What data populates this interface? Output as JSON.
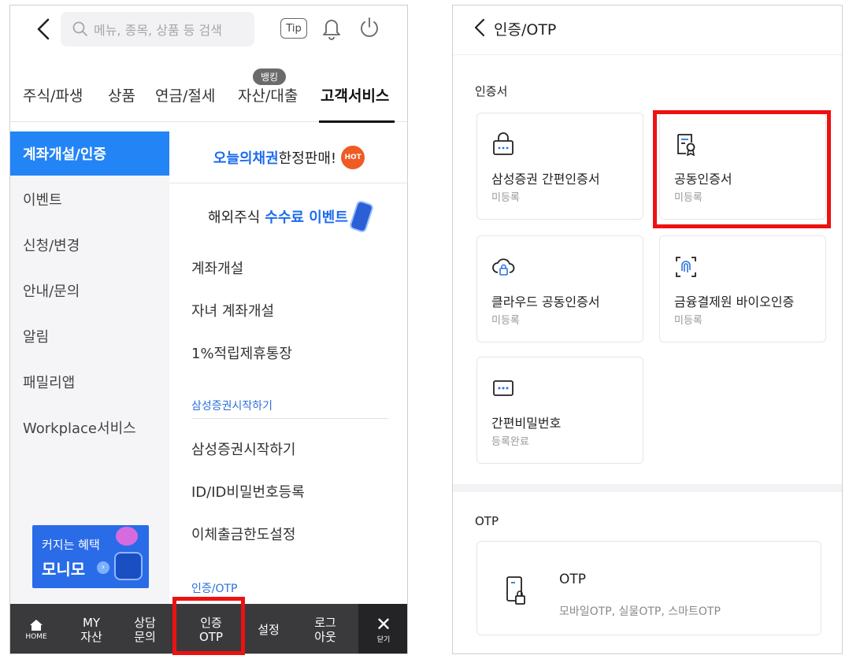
{
  "left": {
    "search": {
      "placeholder": "메뉴, 종목, 상품 등 검색"
    },
    "header": {
      "tip_label": "Tip"
    },
    "tabs": [
      {
        "label": "주식/파생"
      },
      {
        "label": "상품"
      },
      {
        "label": "연금/절세"
      },
      {
        "label": "자산/대출",
        "badge": "뱅킹"
      },
      {
        "label": "고객서비스",
        "active": true
      }
    ],
    "side_menu": [
      {
        "label": "계좌개설/인증",
        "active": true
      },
      {
        "label": "이벤트"
      },
      {
        "label": "신청/변경"
      },
      {
        "label": "안내/문의"
      },
      {
        "label": "알림"
      },
      {
        "label": "패밀리앱"
      },
      {
        "label": "Workplace서비스"
      }
    ],
    "promo": {
      "line1": "커지는 혜택",
      "line2": "모니모",
      "arrow": "›"
    },
    "banners": {
      "bond": {
        "highlight": "오늘의채권",
        "text": " 한정판매!",
        "badge": "HOT"
      },
      "fee": {
        "text": "해외주식",
        "highlight": "수수료 이벤트"
      }
    },
    "menu_items": [
      {
        "label": "계좌개설"
      },
      {
        "label": "자녀 계좌개설"
      },
      {
        "label": "1%적립제휴통장"
      }
    ],
    "section_start": {
      "title": "삼성증권시작하기",
      "items": [
        {
          "label": "삼성증권시작하기"
        },
        {
          "label": "ID/ID비밀번호등록"
        },
        {
          "label": "이체출금한도설정"
        }
      ]
    },
    "section_auth": {
      "title": "인증/OTP"
    },
    "bottom_bar": {
      "home": "HOME",
      "my": [
        "MY",
        "자산"
      ],
      "consult": [
        "상담",
        "문의"
      ],
      "auth": [
        "인증",
        "OTP"
      ],
      "settings": "설정",
      "logout": [
        "로그",
        "아웃"
      ],
      "close_icon": "✕",
      "close": "닫기"
    }
  },
  "right": {
    "title": "인증/OTP",
    "cert_section": "인증서",
    "certs": [
      {
        "name": "삼성증권 간편인증서",
        "status": "미등록",
        "icon": "lock-icon"
      },
      {
        "name": "공동인증서",
        "status": "미등록",
        "icon": "certificate-icon"
      },
      {
        "name": "클라우드 공동인증서",
        "status": "미등록",
        "icon": "cloud-lock-icon"
      },
      {
        "name": "금융결제원 바이오인증",
        "status": "미등록",
        "icon": "fingerprint-icon"
      },
      {
        "name": "간편비밀번호",
        "status": "등록완료",
        "icon": "password-icon"
      }
    ],
    "otp_section": "OTP",
    "otp": {
      "name": "OTP",
      "desc": "모바일OTP, 실물OTP, 스마트OTP",
      "icon": "otp-device-icon"
    }
  },
  "colors": {
    "accent": "#2384f5",
    "highlight": "#ee1111",
    "bottom_bar": "#3a3a3c"
  }
}
